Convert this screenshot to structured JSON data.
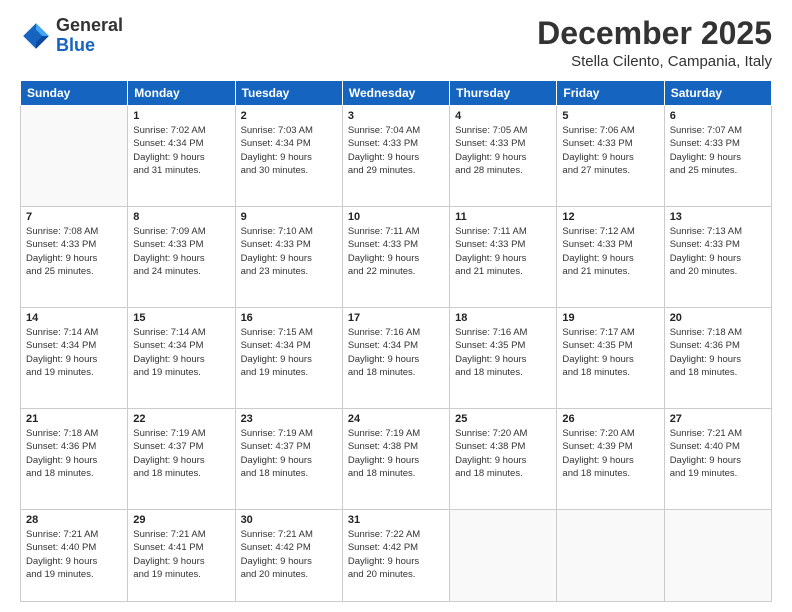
{
  "logo": {
    "general": "General",
    "blue": "Blue"
  },
  "title": "December 2025",
  "location": "Stella Cilento, Campania, Italy",
  "days_of_week": [
    "Sunday",
    "Monday",
    "Tuesday",
    "Wednesday",
    "Thursday",
    "Friday",
    "Saturday"
  ],
  "weeks": [
    [
      {
        "day": "",
        "info": ""
      },
      {
        "day": "1",
        "info": "Sunrise: 7:02 AM\nSunset: 4:34 PM\nDaylight: 9 hours\nand 31 minutes."
      },
      {
        "day": "2",
        "info": "Sunrise: 7:03 AM\nSunset: 4:34 PM\nDaylight: 9 hours\nand 30 minutes."
      },
      {
        "day": "3",
        "info": "Sunrise: 7:04 AM\nSunset: 4:33 PM\nDaylight: 9 hours\nand 29 minutes."
      },
      {
        "day": "4",
        "info": "Sunrise: 7:05 AM\nSunset: 4:33 PM\nDaylight: 9 hours\nand 28 minutes."
      },
      {
        "day": "5",
        "info": "Sunrise: 7:06 AM\nSunset: 4:33 PM\nDaylight: 9 hours\nand 27 minutes."
      },
      {
        "day": "6",
        "info": "Sunrise: 7:07 AM\nSunset: 4:33 PM\nDaylight: 9 hours\nand 25 minutes."
      }
    ],
    [
      {
        "day": "7",
        "info": "Sunrise: 7:08 AM\nSunset: 4:33 PM\nDaylight: 9 hours\nand 25 minutes."
      },
      {
        "day": "8",
        "info": "Sunrise: 7:09 AM\nSunset: 4:33 PM\nDaylight: 9 hours\nand 24 minutes."
      },
      {
        "day": "9",
        "info": "Sunrise: 7:10 AM\nSunset: 4:33 PM\nDaylight: 9 hours\nand 23 minutes."
      },
      {
        "day": "10",
        "info": "Sunrise: 7:11 AM\nSunset: 4:33 PM\nDaylight: 9 hours\nand 22 minutes."
      },
      {
        "day": "11",
        "info": "Sunrise: 7:11 AM\nSunset: 4:33 PM\nDaylight: 9 hours\nand 21 minutes."
      },
      {
        "day": "12",
        "info": "Sunrise: 7:12 AM\nSunset: 4:33 PM\nDaylight: 9 hours\nand 21 minutes."
      },
      {
        "day": "13",
        "info": "Sunrise: 7:13 AM\nSunset: 4:33 PM\nDaylight: 9 hours\nand 20 minutes."
      }
    ],
    [
      {
        "day": "14",
        "info": "Sunrise: 7:14 AM\nSunset: 4:34 PM\nDaylight: 9 hours\nand 19 minutes."
      },
      {
        "day": "15",
        "info": "Sunrise: 7:14 AM\nSunset: 4:34 PM\nDaylight: 9 hours\nand 19 minutes."
      },
      {
        "day": "16",
        "info": "Sunrise: 7:15 AM\nSunset: 4:34 PM\nDaylight: 9 hours\nand 19 minutes."
      },
      {
        "day": "17",
        "info": "Sunrise: 7:16 AM\nSunset: 4:34 PM\nDaylight: 9 hours\nand 18 minutes."
      },
      {
        "day": "18",
        "info": "Sunrise: 7:16 AM\nSunset: 4:35 PM\nDaylight: 9 hours\nand 18 minutes."
      },
      {
        "day": "19",
        "info": "Sunrise: 7:17 AM\nSunset: 4:35 PM\nDaylight: 9 hours\nand 18 minutes."
      },
      {
        "day": "20",
        "info": "Sunrise: 7:18 AM\nSunset: 4:36 PM\nDaylight: 9 hours\nand 18 minutes."
      }
    ],
    [
      {
        "day": "21",
        "info": "Sunrise: 7:18 AM\nSunset: 4:36 PM\nDaylight: 9 hours\nand 18 minutes."
      },
      {
        "day": "22",
        "info": "Sunrise: 7:19 AM\nSunset: 4:37 PM\nDaylight: 9 hours\nand 18 minutes."
      },
      {
        "day": "23",
        "info": "Sunrise: 7:19 AM\nSunset: 4:37 PM\nDaylight: 9 hours\nand 18 minutes."
      },
      {
        "day": "24",
        "info": "Sunrise: 7:19 AM\nSunset: 4:38 PM\nDaylight: 9 hours\nand 18 minutes."
      },
      {
        "day": "25",
        "info": "Sunrise: 7:20 AM\nSunset: 4:38 PM\nDaylight: 9 hours\nand 18 minutes."
      },
      {
        "day": "26",
        "info": "Sunrise: 7:20 AM\nSunset: 4:39 PM\nDaylight: 9 hours\nand 18 minutes."
      },
      {
        "day": "27",
        "info": "Sunrise: 7:21 AM\nSunset: 4:40 PM\nDaylight: 9 hours\nand 19 minutes."
      }
    ],
    [
      {
        "day": "28",
        "info": "Sunrise: 7:21 AM\nSunset: 4:40 PM\nDaylight: 9 hours\nand 19 minutes."
      },
      {
        "day": "29",
        "info": "Sunrise: 7:21 AM\nSunset: 4:41 PM\nDaylight: 9 hours\nand 19 minutes."
      },
      {
        "day": "30",
        "info": "Sunrise: 7:21 AM\nSunset: 4:42 PM\nDaylight: 9 hours\nand 20 minutes."
      },
      {
        "day": "31",
        "info": "Sunrise: 7:22 AM\nSunset: 4:42 PM\nDaylight: 9 hours\nand 20 minutes."
      },
      {
        "day": "",
        "info": ""
      },
      {
        "day": "",
        "info": ""
      },
      {
        "day": "",
        "info": ""
      }
    ]
  ]
}
